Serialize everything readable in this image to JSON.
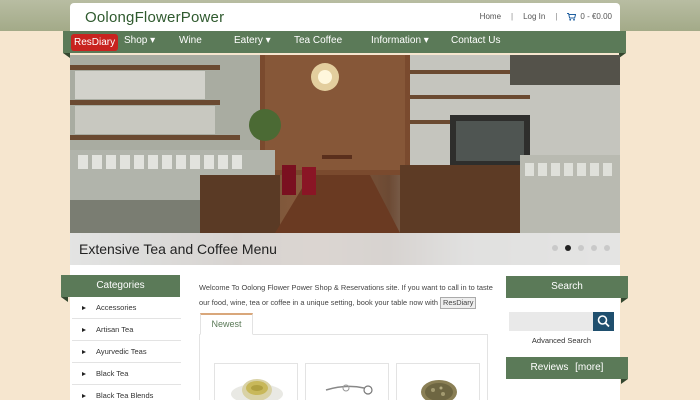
{
  "site": {
    "title": "OolongFlowerPower"
  },
  "toplinks": {
    "home": "Home",
    "login": "Log In",
    "cart": "0 - €0.00"
  },
  "nav": {
    "resdiary": "ResDiary",
    "items": [
      "Shop ▾",
      "Wine",
      "Eatery ▾",
      "Tea Coffee",
      "Information ▾",
      "Contact Us"
    ]
  },
  "slider": {
    "caption": "Extensive Tea and Coffee Menu",
    "active_index": 1,
    "count": 5
  },
  "categories": {
    "heading": "Categories",
    "items": [
      "Accessories",
      "Artisan Tea",
      "Ayurvedic Teas",
      "Black Tea",
      "Black Tea Blends"
    ]
  },
  "welcome": {
    "text": "Welcome To Oolong Flower Power Shop & Reservations site. If you want to call in to taste our food, wine, tea or coffee in a unique setting, book your table now with",
    "button": "ResDiary"
  },
  "tabs": {
    "newest": "Newest"
  },
  "search": {
    "heading": "Search",
    "placeholder": "",
    "advanced": "Advanced Search"
  },
  "reviews": {
    "heading": "Reviews",
    "more": "[more]"
  },
  "icons": [
    "cart-icon",
    "search-icon",
    "bullet-arrow-icon"
  ],
  "colors": {
    "nav_green": "#5b7a58",
    "resdiary_red": "#c8231f",
    "search_blue": "#1f4f6e",
    "page_bg": "#f6e6cf"
  }
}
